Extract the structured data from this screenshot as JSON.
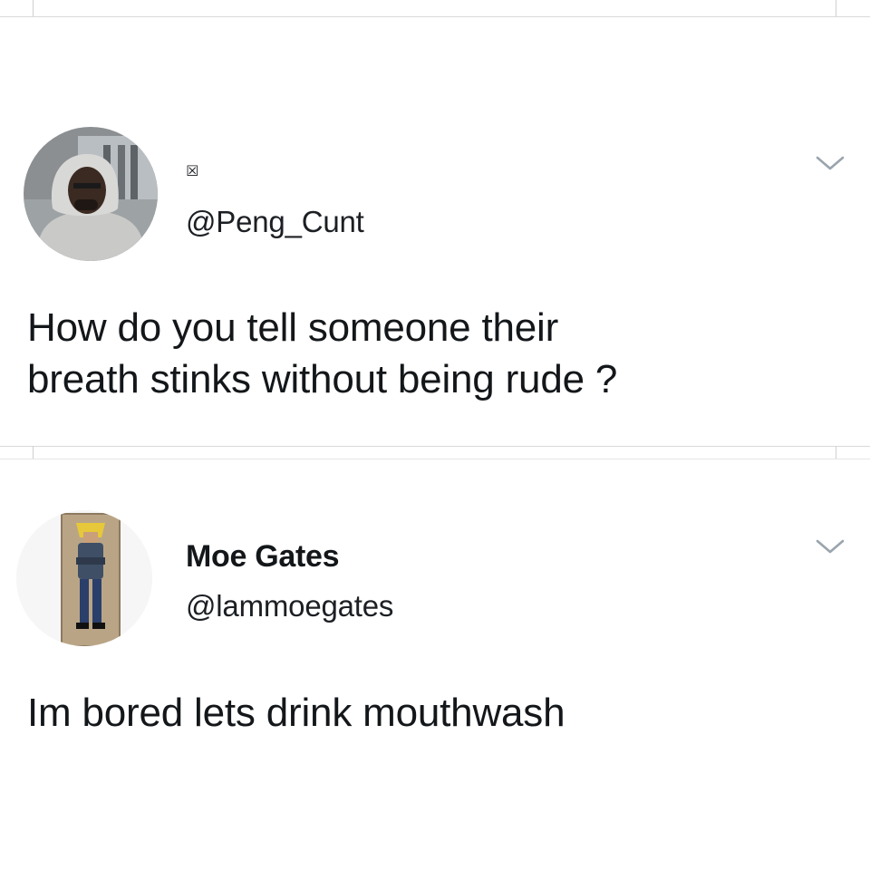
{
  "tweets": [
    {
      "display_name": "☒",
      "handle": "@Peng_Cunt",
      "text_lines": [
        "How do you tell someone their",
        "breath stinks without being rude ?"
      ],
      "avatar_icon": "user-photo-hooded-man",
      "menu_icon": "chevron-down-icon"
    },
    {
      "display_name": "Moe Gates",
      "handle": "@lammoegates",
      "text_lines": [
        "Im bored lets drink mouthwash"
      ],
      "avatar_icon": "user-photo-standing-man",
      "menu_icon": "chevron-down-icon"
    }
  ],
  "colors": {
    "text": "#14171a",
    "divider": "#d9d9d9",
    "chevron": "#9aa4ad",
    "background": "#ffffff"
  }
}
